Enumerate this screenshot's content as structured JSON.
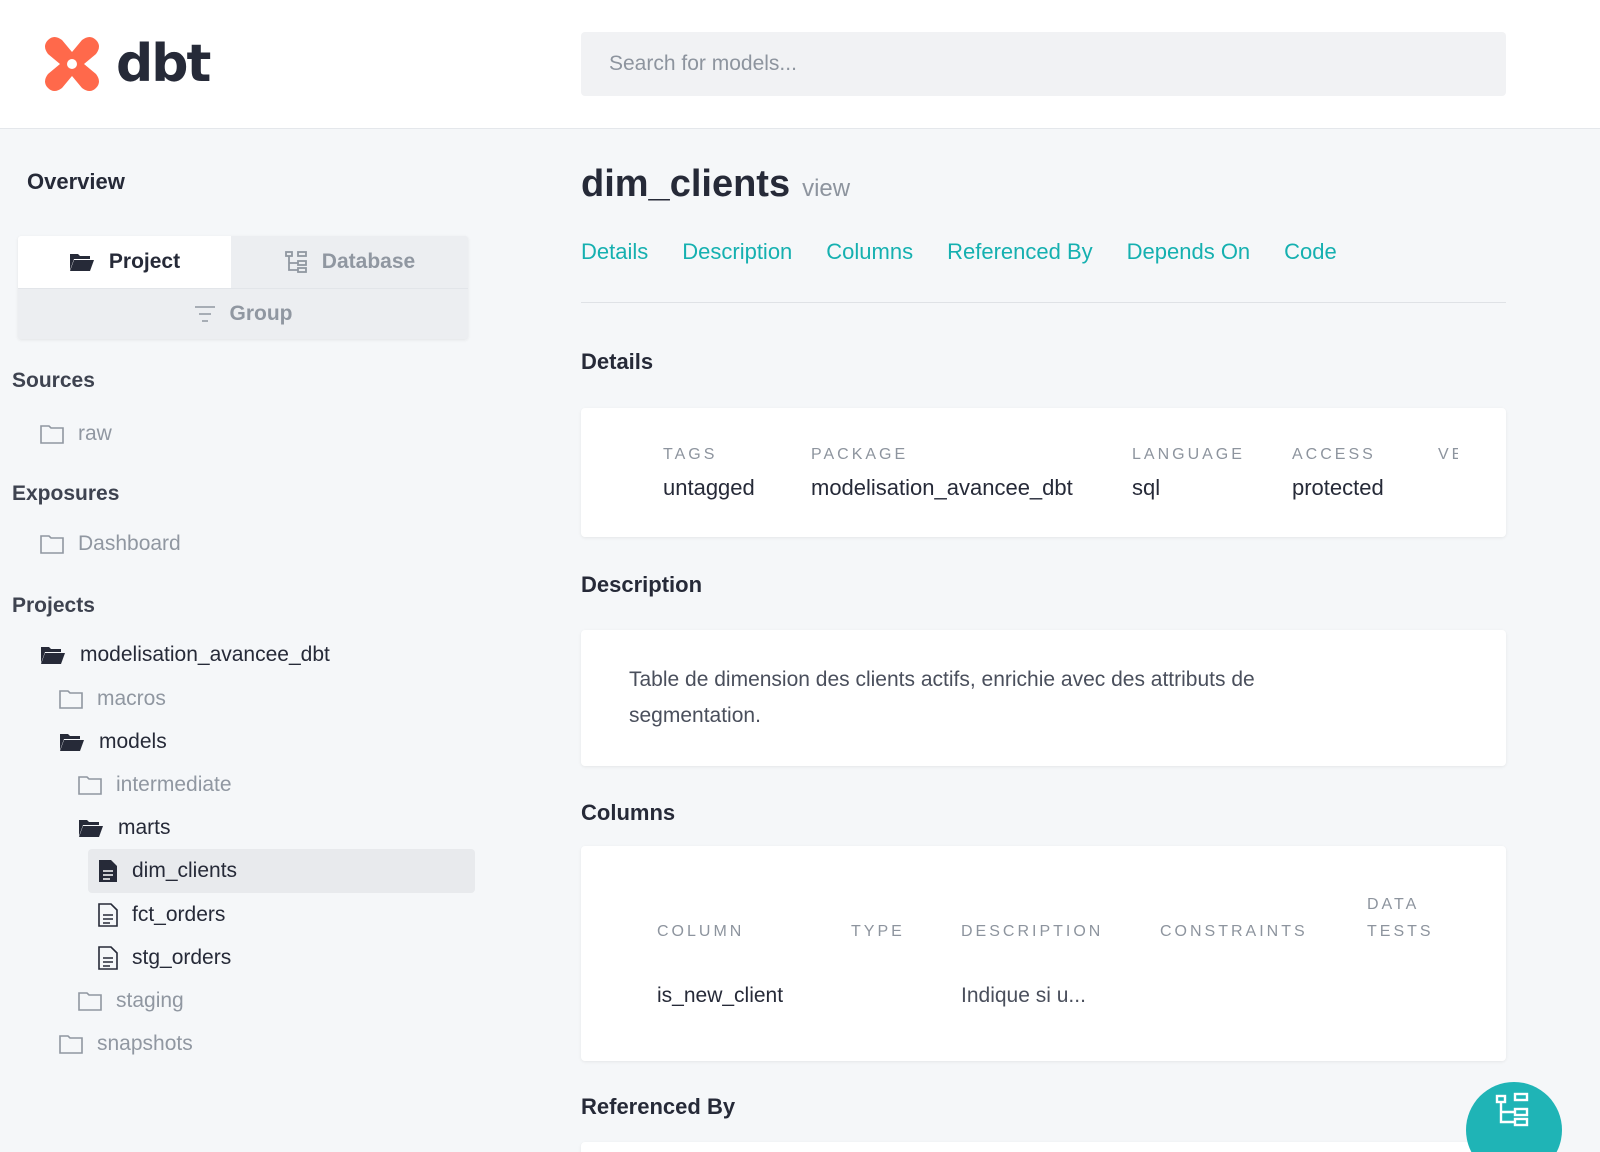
{
  "header": {
    "logo_text": "dbt",
    "search_placeholder": "Search for models..."
  },
  "sidebar": {
    "overview_label": "Overview",
    "tabs": {
      "project": "Project",
      "database": "Database",
      "group": "Group"
    },
    "sections": {
      "sources": "Sources",
      "exposures": "Exposures",
      "projects": "Projects"
    },
    "tree": {
      "raw": "raw",
      "dashboard": "Dashboard",
      "project_root": "modelisation_avancee_dbt",
      "macros": "macros",
      "models": "models",
      "intermediate": "intermediate",
      "marts": "marts",
      "dim_clients": "dim_clients",
      "fct_orders": "fct_orders",
      "stg_orders": "stg_orders",
      "staging": "staging",
      "snapshots": "snapshots"
    }
  },
  "main": {
    "model_name": "dim_clients",
    "model_type": "view",
    "nav": [
      "Details",
      "Description",
      "Columns",
      "Referenced By",
      "Depends On",
      "Code"
    ],
    "details": {
      "heading": "Details",
      "tags_label": "TAGS",
      "tags_value": "untagged",
      "package_label": "PACKAGE",
      "package_value": "modelisation_avancee_dbt",
      "language_label": "LANGUAGE",
      "language_value": "sql",
      "access_label": "ACCESS",
      "access_value": "protected",
      "cut_label": "VE"
    },
    "description": {
      "heading": "Description",
      "text": "Table de dimension des clients actifs, enrichie avec des attributs de segmentation."
    },
    "columns": {
      "heading": "Columns",
      "headers": {
        "column": "COLUMN",
        "type": "TYPE",
        "description": "DESCRIPTION",
        "constraints": "CONSTRAINTS",
        "data_tests_1": "DATA",
        "data_tests_2": "TESTS"
      },
      "rows": [
        {
          "column": "is_new_client",
          "type": "",
          "description": "Indique si u..."
        }
      ]
    },
    "referenced_by": {
      "heading": "Referenced By"
    }
  },
  "colors": {
    "accent": "#15b0b0",
    "logo": "#ff694b",
    "fab": "#1fb4b6"
  }
}
